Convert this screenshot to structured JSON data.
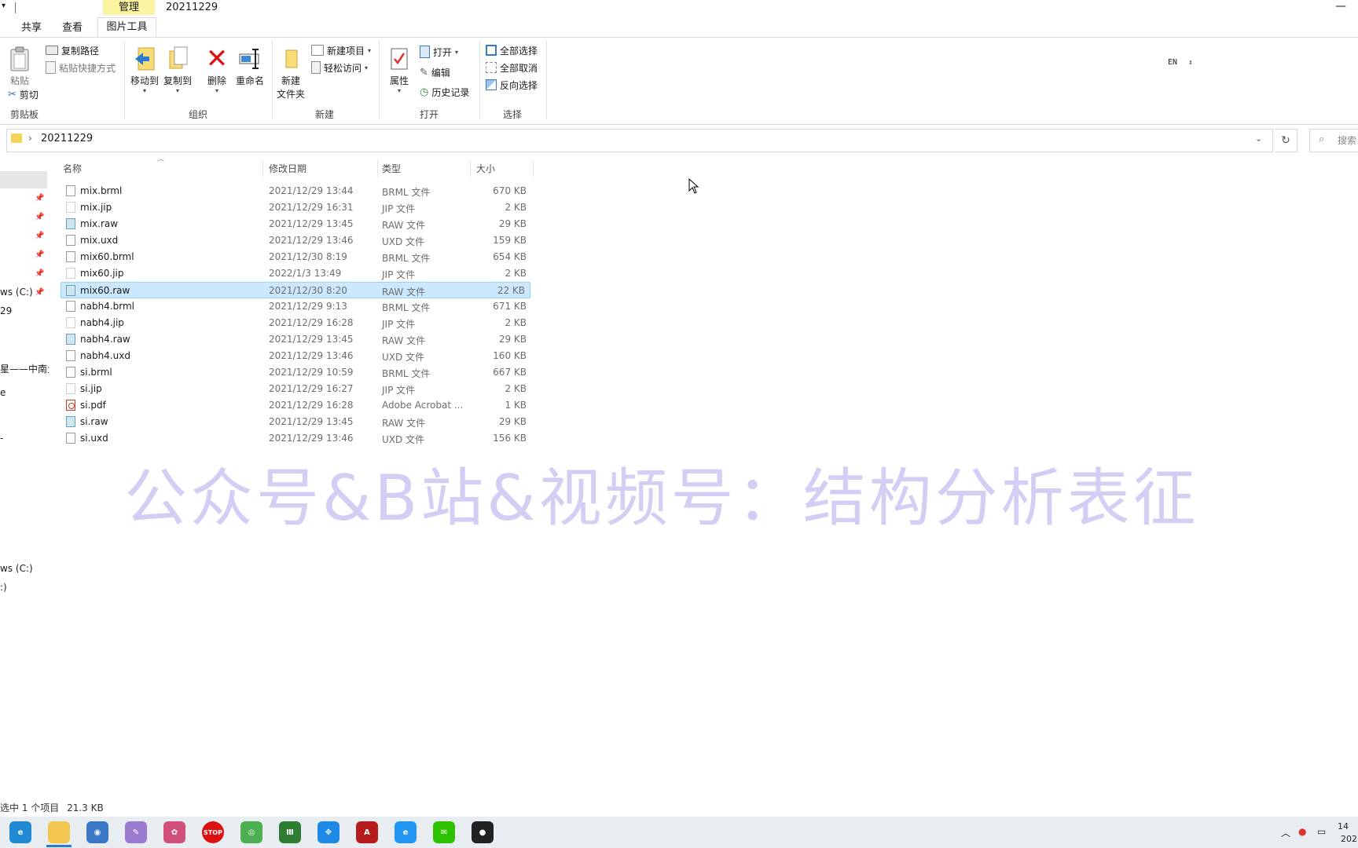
{
  "window": {
    "context_tab": "管理",
    "title": "20211229",
    "minimize_glyph": "—"
  },
  "ribbon_tabs": [
    "共享",
    "查看",
    "图片工具"
  ],
  "ribbon": {
    "clipboard": {
      "label": "剪贴板",
      "paste": "粘贴",
      "copy_path": "复制路径",
      "paste_shortcut": "粘贴快捷方式",
      "cut": "剪切"
    },
    "organize": {
      "label": "组织",
      "move_to": "移动到",
      "copy_to": "复制到",
      "delete": "删除",
      "rename": "重命名"
    },
    "new": {
      "label": "新建",
      "new_folder_line1": "新建",
      "new_folder_line2": "文件夹",
      "new_item": "新建项目",
      "easy_access": "轻松访问"
    },
    "open": {
      "label": "打开",
      "properties": "属性",
      "open": "打开",
      "edit": "编辑",
      "history": "历史记录"
    },
    "select": {
      "label": "选择",
      "select_all": "全部选择",
      "select_none": "全部取消",
      "invert": "反向选择"
    }
  },
  "language_indicator": "EN",
  "address": {
    "path": "20211229",
    "search_placeholder": "搜索"
  },
  "nav": {
    "items": [
      "ws (C:)",
      "29",
      "星——中南大",
      "e",
      "-",
      "ws (C:)",
      ":)"
    ]
  },
  "columns": {
    "name": "名称",
    "date": "修改日期",
    "type": "类型",
    "size": "大小"
  },
  "files": [
    {
      "name": "mix.brml",
      "date": "2021/12/29 13:44",
      "type": "BRML 文件",
      "size": "670 KB",
      "icon": "file-icon"
    },
    {
      "name": "mix.jip",
      "date": "2021/12/29 16:31",
      "type": "JIP 文件",
      "size": "2 KB",
      "icon": "blank-file-icon"
    },
    {
      "name": "mix.raw",
      "date": "2021/12/29 13:45",
      "type": "RAW 文件",
      "size": "29 KB",
      "icon": "raw-file-icon"
    },
    {
      "name": "mix.uxd",
      "date": "2021/12/29 13:46",
      "type": "UXD 文件",
      "size": "159 KB",
      "icon": "file-icon"
    },
    {
      "name": "mix60.brml",
      "date": "2021/12/30 8:19",
      "type": "BRML 文件",
      "size": "654 KB",
      "icon": "file-icon"
    },
    {
      "name": "mix60.jip",
      "date": "2022/1/3 13:49",
      "type": "JIP 文件",
      "size": "2 KB",
      "icon": "blank-file-icon"
    },
    {
      "name": "mix60.raw",
      "date": "2021/12/30 8:20",
      "type": "RAW 文件",
      "size": "22 KB",
      "icon": "raw-file-icon",
      "selected": true
    },
    {
      "name": "nabh4.brml",
      "date": "2021/12/29 9:13",
      "type": "BRML 文件",
      "size": "671 KB",
      "icon": "file-icon"
    },
    {
      "name": "nabh4.jip",
      "date": "2021/12/29 16:28",
      "type": "JIP 文件",
      "size": "2 KB",
      "icon": "blank-file-icon"
    },
    {
      "name": "nabh4.raw",
      "date": "2021/12/29 13:45",
      "type": "RAW 文件",
      "size": "29 KB",
      "icon": "raw-file-icon"
    },
    {
      "name": "nabh4.uxd",
      "date": "2021/12/29 13:46",
      "type": "UXD 文件",
      "size": "160 KB",
      "icon": "file-icon"
    },
    {
      "name": "si.brml",
      "date": "2021/12/29 10:59",
      "type": "BRML 文件",
      "size": "667 KB",
      "icon": "file-icon"
    },
    {
      "name": "si.jip",
      "date": "2021/12/29 16:27",
      "type": "JIP 文件",
      "size": "2 KB",
      "icon": "blank-file-icon"
    },
    {
      "name": "si.pdf",
      "date": "2021/12/29 16:28",
      "type": "Adobe Acrobat ...",
      "size": "1 KB",
      "icon": "pdf-file-icon"
    },
    {
      "name": "si.raw",
      "date": "2021/12/29 13:45",
      "type": "RAW 文件",
      "size": "29 KB",
      "icon": "raw-file-icon"
    },
    {
      "name": "si.uxd",
      "date": "2021/12/29 13:46",
      "type": "UXD 文件",
      "size": "156 KB",
      "icon": "file-icon"
    }
  ],
  "watermark": "公众号&B站&视频号：结构分析表征",
  "status": {
    "selection": "选中 1 个项目",
    "size": "21.3 KB"
  },
  "taskbar": {
    "apps": [
      {
        "name": "edge-icon",
        "color": "#1f8ad2",
        "glyph": "e"
      },
      {
        "name": "file-explorer-icon",
        "color": "#f3c74f",
        "glyph": ""
      },
      {
        "name": "app3-icon",
        "color": "#3b78c4",
        "glyph": "◉"
      },
      {
        "name": "app4-icon",
        "color": "#9a7bd0",
        "glyph": "✎"
      },
      {
        "name": "app5-icon",
        "color": "#d14f7a",
        "glyph": "✿"
      },
      {
        "name": "stop-icon",
        "color": "#d11",
        "glyph": "STOP"
      },
      {
        "name": "chrome-icon",
        "color": "#4caf50",
        "glyph": "◎"
      },
      {
        "name": "origin-icon",
        "color": "#2e7d32",
        "glyph": "Ⅲ"
      },
      {
        "name": "app9-icon",
        "color": "#1e88e5",
        "glyph": "✥"
      },
      {
        "name": "acrobat-icon",
        "color": "#b71c1c",
        "glyph": "A"
      },
      {
        "name": "ie-icon",
        "color": "#2196f3",
        "glyph": "e"
      },
      {
        "name": "wechat-icon",
        "color": "#2dc100",
        "glyph": "✉"
      },
      {
        "name": "obs-icon",
        "color": "#222",
        "glyph": "●"
      }
    ],
    "clock_time": "14",
    "clock_date": "202"
  }
}
